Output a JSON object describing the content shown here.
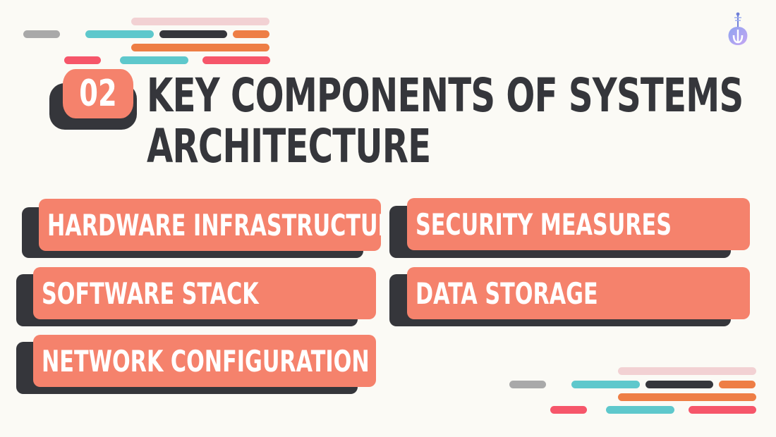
{
  "slide": {
    "number": "02",
    "title_line1": "KEY COMPONENTS OF SYSTEMS",
    "title_line2": "ARCHITECTURE"
  },
  "components": [
    {
      "label": "HARDWARE INFRASTRUCTURE"
    },
    {
      "label": "SECURITY MEASURES"
    },
    {
      "label": "SOFTWARE STACK"
    },
    {
      "label": "DATA STORAGE"
    },
    {
      "label": "NETWORK CONFIGURATION"
    }
  ],
  "icons": {
    "logo": "violin-logo-icon"
  },
  "colors": {
    "background": "#fbfaf5",
    "accent": "#f5826c",
    "dark": "#35363b",
    "teal": "#5ec8cc",
    "orange": "#ee7e45",
    "pink": "#f2d1d3",
    "red": "#f6566a",
    "gray": "#a9a9a9"
  }
}
